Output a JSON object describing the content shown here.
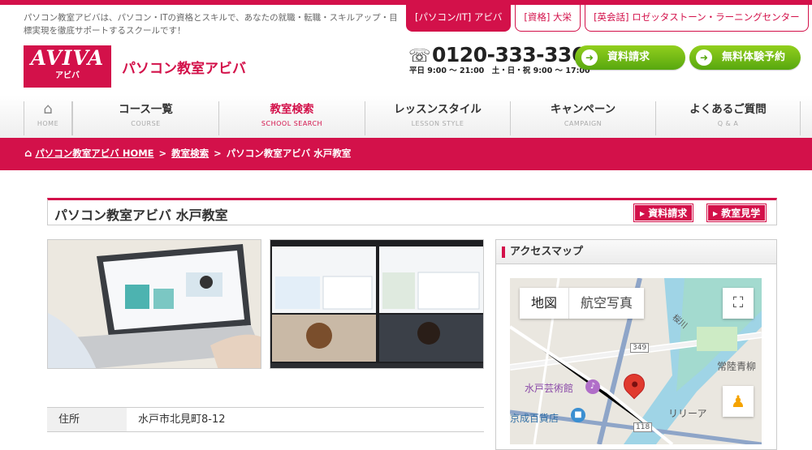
{
  "header": {
    "tagline": "パソコン教室アビバは、パソコン・ITの資格とスキルで、あなたの就職・転職・スキルアップ・目標実現を徹底サポートするスクールです！",
    "tabs": [
      {
        "label": "[パソコン/IT] アビバ",
        "active": true
      },
      {
        "label": "[資格] 大栄",
        "active": false
      },
      {
        "label": "[英会話] ロゼッタストーン・ラーニングセンター",
        "active": false
      }
    ],
    "logo_text": "AVIVA",
    "logo_sub": "アビバ",
    "brand": "パソコン教室アビバ",
    "phone": "0120-333-336",
    "hours": "平日 9:00 〜 21:00　土・日・祝 9:00 〜 17:00",
    "buttons": {
      "request": "資料請求",
      "trial": "無料体験予約"
    }
  },
  "nav": {
    "home_label": "HOME",
    "items": [
      {
        "jp": "コース一覧",
        "en": "COURSE",
        "active": false
      },
      {
        "jp": "教室検索",
        "en": "SCHOOL SEARCH",
        "active": true
      },
      {
        "jp": "レッスンスタイル",
        "en": "LESSON STYLE",
        "active": false
      },
      {
        "jp": "キャンペーン",
        "en": "CAMPAIGN",
        "active": false
      },
      {
        "jp": "よくあるご質問",
        "en": "Q & A",
        "active": false
      }
    ]
  },
  "breadcrumb": {
    "home": "パソコン教室アビバ HOME",
    "search": "教室検索",
    "current": "パソコン教室アビバ 水戸教室",
    "sep": ">"
  },
  "school": {
    "title": "パソコン教室アビバ 水戸教室",
    "btn_request": "資料請求",
    "btn_visit": "教室見学",
    "info": [
      {
        "key": "住所",
        "value": "水戸市北見町8-12"
      }
    ]
  },
  "map": {
    "heading": "アクセスマップ",
    "tab_map": "地図",
    "tab_satellite": "航空写真",
    "labels": {
      "geijutsukan": "水戸芸術館",
      "keisei": "京成百貨店",
      "hitachi": "常陸青柳",
      "lily": "リリーア",
      "river": "桜川",
      "road349": "349",
      "road118": "118"
    }
  },
  "colors": {
    "brand": "#d3114a",
    "green": "#6ab816"
  }
}
